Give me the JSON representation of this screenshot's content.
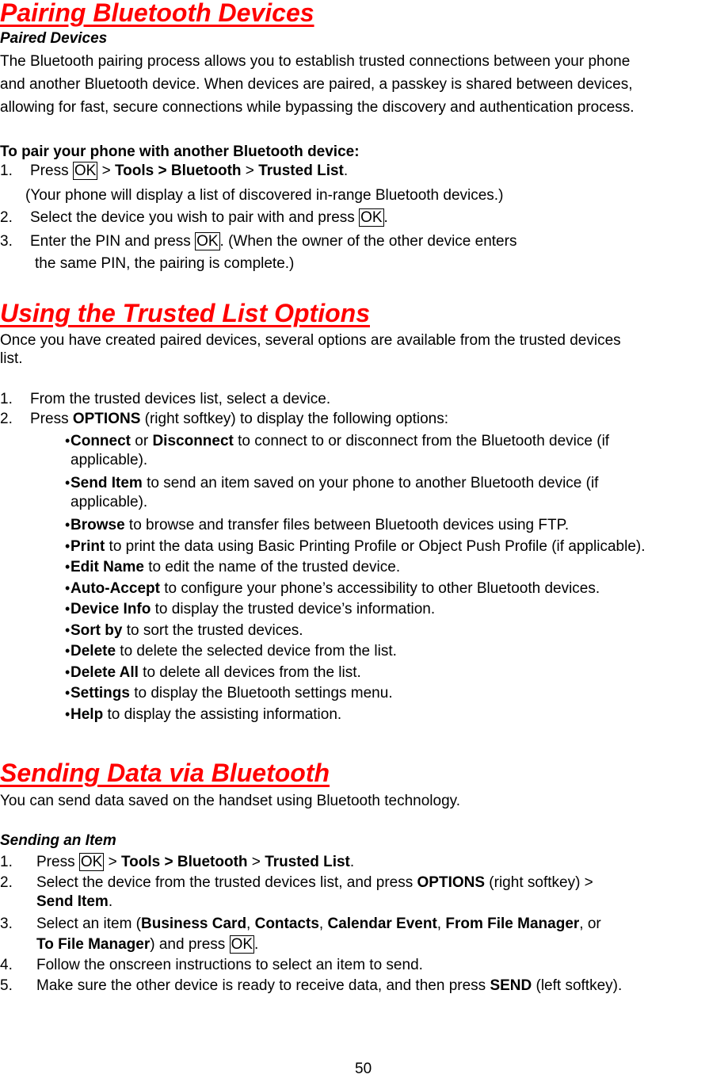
{
  "section1": {
    "title": "Pairing Bluetooth Devices",
    "subtitle": "Paired Devices",
    "intro_lines": [
      "The Bluetooth pairing process allows you to establish trusted connections between your phone",
      "and another Bluetooth device. When devices are paired, a passkey is shared between devices,",
      "allowing for fast, secure connections while bypassing the discovery and authentication process."
    ],
    "procedure_title": "To pair your phone with another Bluetooth device:",
    "steps": [
      {
        "num": "1.",
        "pre": "Press ",
        "key": "OK",
        "mid": " > ",
        "b1": "Tools > Bluetooth",
        "sep": " > ",
        "b2": "Trusted List",
        "end": "."
      },
      {
        "note": "(Your phone will display a list of discovered in-range Bluetooth devices.)"
      },
      {
        "num": "2.",
        "pre": "Select the device you wish to pair with and press ",
        "key": "OK",
        "end": "."
      },
      {
        "num": "3.",
        "pre": "Enter the PIN and press ",
        "key": "OK",
        "end": ". (When the owner of the other device enters",
        "cont": "the same PIN, the pairing is complete.)"
      }
    ]
  },
  "section2": {
    "title": "Using the Trusted List Options",
    "intro_lines": [
      "Once you have created paired devices, several options are available from the trusted devices",
      "list."
    ],
    "steps": [
      {
        "num": "1.",
        "text": "From the trusted devices list, select a device."
      },
      {
        "num": "2.",
        "pre": "Press ",
        "bold": "OPTIONS",
        "post": " (right softkey) to display the following options:"
      }
    ],
    "options": [
      {
        "b1": "Connect",
        "mid": " or ",
        "b2": "Disconnect",
        "text": " to connect to or disconnect from the Bluetooth device (if",
        "cont": "applicable)."
      },
      {
        "b1": "Send Item",
        "text": " to send an item saved on your phone to another Bluetooth device (if",
        "cont": "applicable)."
      },
      {
        "b1": "Browse",
        "text": " to browse and transfer files between Bluetooth devices using FTP."
      },
      {
        "b1": "Print",
        "text": " to print the data using Basic Printing Profile or Object Push Profile (if applicable)."
      },
      {
        "b1": "Edit Name",
        "text": " to edit the name of the trusted device."
      },
      {
        "b1": "Auto-Accept",
        "text": " to configure your phone’s accessibility to other Bluetooth devices."
      },
      {
        "b1": "Device Info",
        "text": " to display the trusted device’s information."
      },
      {
        "b1": "Sort by",
        "text": " to sort the trusted devices."
      },
      {
        "b1": "Delete",
        "text": " to delete the selected device from the list."
      },
      {
        "b1": "Delete All",
        "text": " to delete all devices from the list."
      },
      {
        "b1": "Settings",
        "text": " to display the Bluetooth settings menu."
      },
      {
        "b1": "Help",
        "text": " to display the assisting information."
      }
    ]
  },
  "section3": {
    "title": "Sending Data via Bluetooth",
    "intro": "You can send data saved on the handset using Bluetooth technology.",
    "subtitle": "Sending an Item",
    "steps": [
      {
        "num": "1.",
        "pre": "Press ",
        "key": "OK",
        "mid": " > ",
        "b1": "Tools > Bluetooth",
        "sep": " > ",
        "b2": "Trusted List",
        "end": "."
      },
      {
        "num": "2.",
        "pre": "Select the device from the trusted devices list, and press ",
        "b1": "OPTIONS",
        "post": " (right softkey) >",
        "cont_b": "Send Item",
        "cont_end": "."
      },
      {
        "num": "3.",
        "pre": "Select an item (",
        "b1": "Business Card",
        "c1": ", ",
        "b2": "Contacts",
        "c2": ", ",
        "b3": "Calendar Event",
        "c3": ", ",
        "b4": "From File Manager",
        "post": ", or",
        "cont_b": "To File Manager",
        "cont_mid": ") and press ",
        "key": "OK",
        "cont_end": "."
      },
      {
        "num": "4.",
        "text": "Follow the onscreen instructions to select an item to send."
      },
      {
        "num": "5.",
        "pre": "Make sure the other device is ready to receive data, and then press ",
        "b1": "SEND",
        "post": " (left softkey)."
      }
    ]
  },
  "footer": {
    "page_number": "50"
  }
}
